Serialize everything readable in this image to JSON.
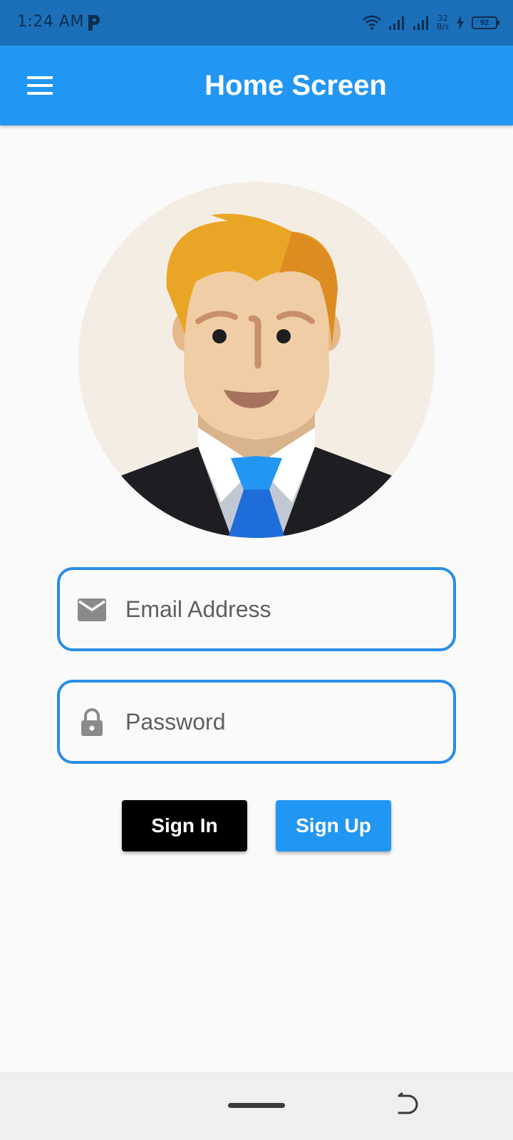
{
  "status_bar": {
    "time": "1:24 AM",
    "speed_value": "32",
    "speed_unit": "B/s",
    "battery": "92"
  },
  "app_bar": {
    "title": "Home Screen"
  },
  "form": {
    "email_placeholder": "Email Address",
    "password_placeholder": "Password"
  },
  "buttons": {
    "sign_in": "Sign In",
    "sign_up": "Sign Up"
  },
  "colors": {
    "primary": "#2196f3",
    "status_bar": "#1b6fb8",
    "field_border": "#2a8de6",
    "sign_in_bg": "#000000",
    "background": "#fafafa"
  },
  "icons": {
    "menu": "hamburger-menu-icon",
    "email": "envelope-icon",
    "password": "padlock-icon"
  }
}
